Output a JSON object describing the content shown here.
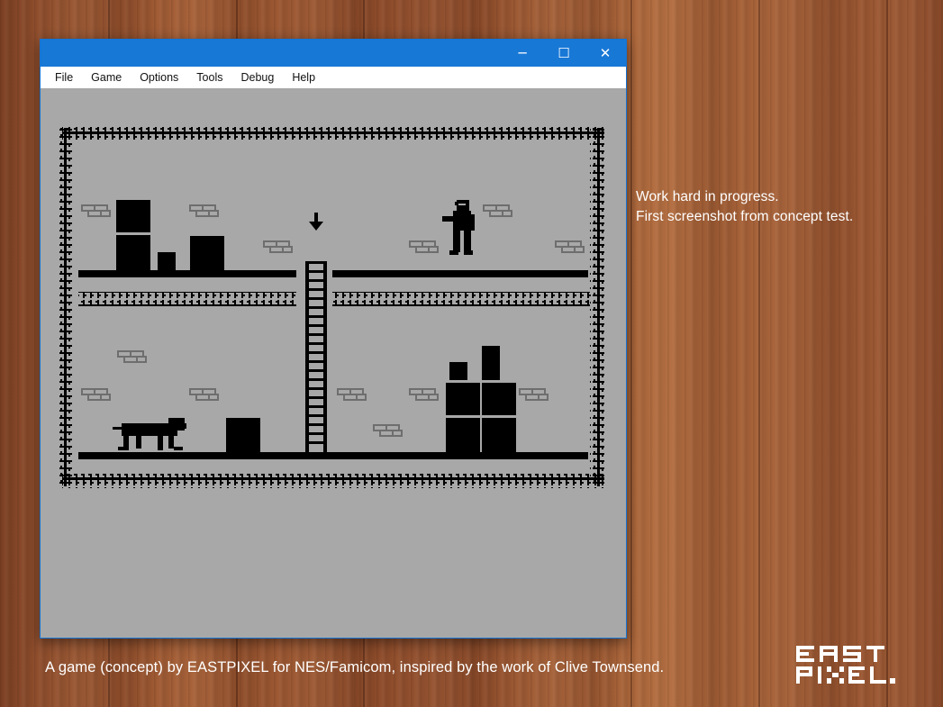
{
  "window": {
    "menu": [
      "File",
      "Game",
      "Options",
      "Tools",
      "Debug",
      "Help"
    ],
    "controls": {
      "minimize": "─",
      "maximize": "☐",
      "close": "✕"
    },
    "accent": "#1878d6"
  },
  "game": {
    "palette": {
      "background": "#a8a8a8",
      "ink": "#000000",
      "bricks": "#6e6e6e"
    }
  },
  "notes": {
    "line1": "Work hard in progress.",
    "line2": "First screenshot from concept test."
  },
  "footer": {
    "credit": "A game (concept) by EASTPIXEL for NES/Famicom, inspired by the work of Clive Townsend."
  },
  "logo": {
    "text": "EASTPIXEL"
  }
}
